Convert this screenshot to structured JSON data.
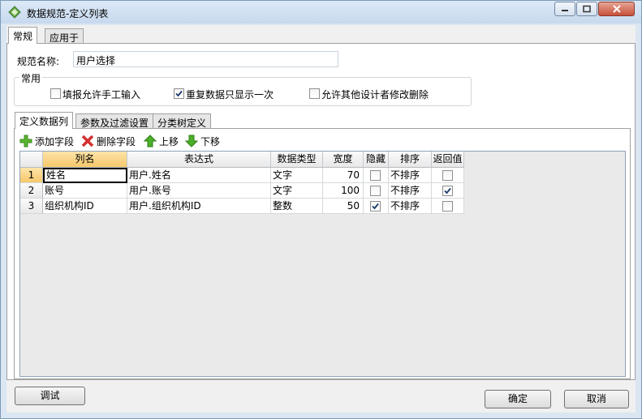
{
  "window": {
    "title": "数据规范-定义列表"
  },
  "tabs": [
    {
      "label": "常规"
    },
    {
      "label": "应用于"
    }
  ],
  "general": {
    "name_label": "规范名称:",
    "name_value": "用户选择",
    "group_title": "常用",
    "options": [
      {
        "label": "填报允许手工输入",
        "checked": false
      },
      {
        "label": "重复数据只显示一次",
        "checked": true
      },
      {
        "label": "允许其他设计者修改删除",
        "checked": false
      }
    ]
  },
  "subtabs": [
    {
      "label": "定义数据列"
    },
    {
      "label": "参数及过滤设置"
    },
    {
      "label": "分类树定义"
    }
  ],
  "toolbar": {
    "add": "添加字段",
    "delete": "删除字段",
    "up": "上移",
    "down": "下移"
  },
  "grid": {
    "columns": [
      "列名",
      "表达式",
      "数据类型",
      "宽度",
      "隐藏",
      "排序",
      "返回值"
    ],
    "rows": [
      {
        "index": "1",
        "name": "姓名",
        "expr": "用户.姓名",
        "type": "文字",
        "width": "70",
        "hidden": false,
        "sort": "不排序",
        "return": false
      },
      {
        "index": "2",
        "name": "账号",
        "expr": "用户.账号",
        "type": "文字",
        "width": "100",
        "hidden": false,
        "sort": "不排序",
        "return": true
      },
      {
        "index": "3",
        "name": "组织机构ID",
        "expr": "用户.组织机构ID",
        "type": "整数",
        "width": "50",
        "hidden": true,
        "sort": "不排序",
        "return": false
      }
    ]
  },
  "buttons": {
    "debug": "调试",
    "ok": "确定",
    "cancel": "取消"
  }
}
